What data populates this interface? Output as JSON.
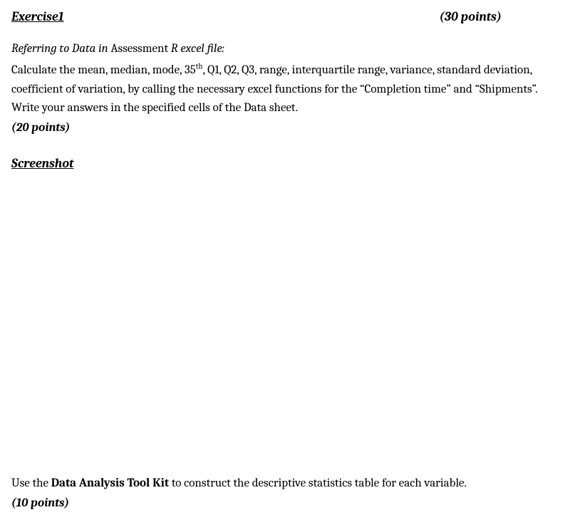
{
  "header": {
    "title": "Exercise1",
    "points": "(30 points)"
  },
  "intro": {
    "prefix": "Referring to Data in ",
    "mid": "Assessment ",
    "suffix": "R excel file:"
  },
  "instructions": {
    "pre": " Calculate the mean, median, mode, 35",
    "sup": "th",
    "post": ", Q1, Q2, Q3, range, interquartile range, variance, standard deviation, coefficient of variation, by calling the necessary excel functions for the “Completion time” and “Shipments”. Write your answers in the specified cells of the Data sheet."
  },
  "sub_points_1": "(20 points)",
  "screenshot_heading": "Screenshot",
  "part2": {
    "pre": "Use the ",
    "bold": "Data Analysis Tool Kit",
    "post": " to construct the descriptive statistics table for each variable."
  },
  "sub_points_2": "(10 points)"
}
